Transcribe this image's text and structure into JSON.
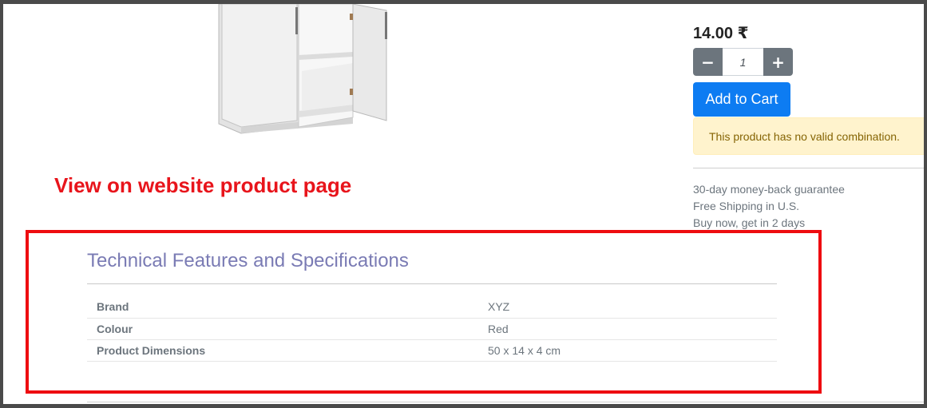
{
  "product": {
    "price": "14.00 ₹",
    "quantity": "1",
    "add_to_cart_label": "Add to Cart",
    "alert_message": "This product has no valid combination.",
    "guarantees": [
      "30-day money-back guarantee",
      "Free Shipping in U.S.",
      "Buy now, get in 2 days"
    ]
  },
  "annotation": {
    "text": "View on website product page",
    "color": "#e8141b"
  },
  "specs": {
    "title": "Technical Features and Specifications",
    "rows": [
      {
        "label": "Brand",
        "value": "XYZ"
      },
      {
        "label": "Colour",
        "value": "Red"
      },
      {
        "label": "Product Dimensions",
        "value": "50 x 14 x 4 cm"
      }
    ]
  },
  "icons": {
    "minus": "minus-icon",
    "plus": "plus-icon",
    "product_image": "cabinet-image"
  },
  "colors": {
    "primary": "#0d7cf2",
    "secondary": "#6c757d",
    "highlight": "#ee0c10",
    "title": "#7a7bb4"
  }
}
